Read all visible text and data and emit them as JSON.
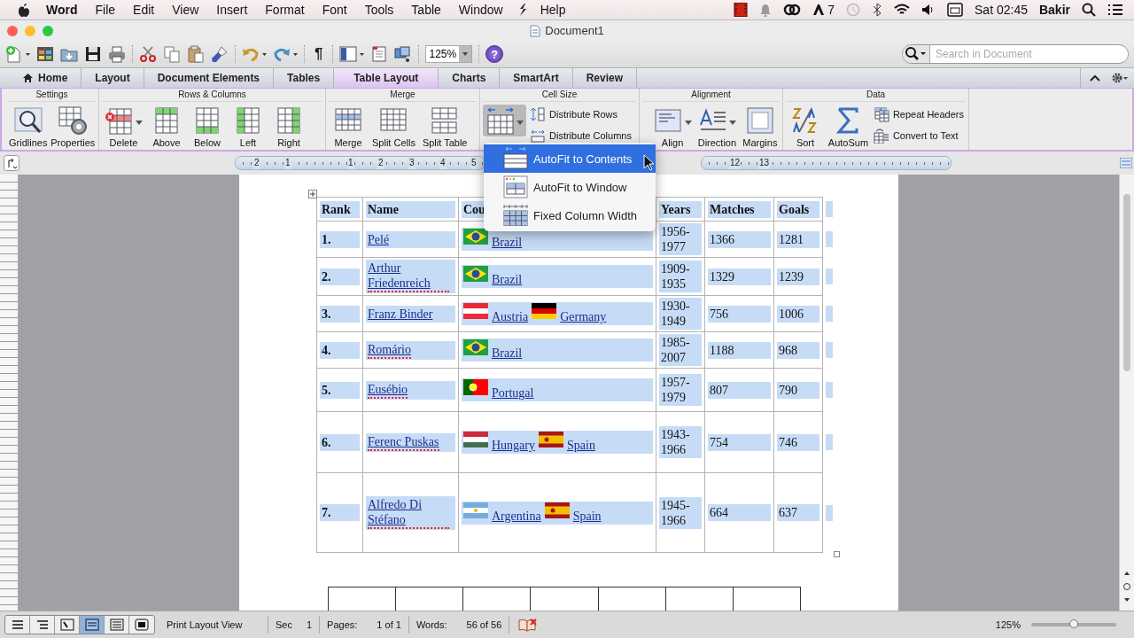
{
  "menubar": {
    "app": "Word",
    "items": [
      "File",
      "Edit",
      "View",
      "Insert",
      "Format",
      "Font",
      "Tools",
      "Table",
      "Window",
      "Help"
    ],
    "badge_count": "7",
    "clock": "Sat 02:45",
    "user": "Bakir"
  },
  "window": {
    "title": "Document1"
  },
  "toolbar": {
    "pilcrow": "¶",
    "zoom": "125%",
    "help": "?",
    "search": {
      "placeholder": "Search in Document"
    }
  },
  "ribbon": {
    "tabs": [
      {
        "label": "Home",
        "kind": "home",
        "selected": false
      },
      {
        "label": "Layout",
        "kind": "plain",
        "selected": false
      },
      {
        "label": "Document Elements",
        "kind": "plain",
        "selected": false
      },
      {
        "label": "Tables",
        "kind": "plain",
        "selected": false
      },
      {
        "label": "Table Layout",
        "kind": "plain",
        "selected": true
      },
      {
        "label": "Charts",
        "kind": "plain",
        "selected": false
      },
      {
        "label": "SmartArt",
        "kind": "plain",
        "selected": false
      },
      {
        "label": "Review",
        "kind": "plain",
        "selected": false
      }
    ],
    "groups": [
      {
        "title": "Settings",
        "buttons": [
          {
            "label": "Gridlines",
            "kind": "gridlines"
          },
          {
            "label": "Properties",
            "kind": "properties"
          }
        ]
      },
      {
        "title": "Rows & Columns",
        "buttons": [
          {
            "label": "Delete",
            "kind": "delete",
            "dropdown": true
          },
          {
            "label": "Above",
            "kind": "above"
          },
          {
            "label": "Below",
            "kind": "below"
          },
          {
            "label": "Left",
            "kind": "left"
          },
          {
            "label": "Right",
            "kind": "right"
          }
        ]
      },
      {
        "title": "Merge",
        "buttons": [
          {
            "label": "Merge",
            "kind": "merge"
          },
          {
            "label": "Split Cells",
            "kind": "split-cells"
          },
          {
            "label": "Split Table",
            "kind": "split-table"
          }
        ]
      },
      {
        "title": "Cell Size",
        "buttons": [
          {
            "kind": "autofit",
            "dropdown": true,
            "pressed": true
          }
        ],
        "small_buttons": [
          {
            "label": "Distribute Rows",
            "kind": "dist-rows"
          },
          {
            "label": "Distribute Columns",
            "kind": "dist-cols"
          }
        ]
      },
      {
        "title": "Alignment",
        "buttons": [
          {
            "label": "Align",
            "kind": "align",
            "dropdown": true
          },
          {
            "label": "Direction",
            "kind": "direction",
            "dropdown": true
          },
          {
            "label": "Margins",
            "kind": "margins"
          }
        ]
      },
      {
        "title": "Data",
        "buttons": [
          {
            "label": "Sort",
            "kind": "sort"
          },
          {
            "label": "AutoSum",
            "kind": "sum"
          }
        ],
        "small_buttons": [
          {
            "label": "Repeat Headers",
            "kind": "repeat"
          },
          {
            "label": "Convert to Text",
            "kind": "convert"
          }
        ]
      }
    ]
  },
  "ruler": {
    "labels": [
      "2",
      "1",
      "1",
      "2",
      "3",
      "4",
      "5",
      "12",
      "13"
    ]
  },
  "autofit_menu": {
    "items": [
      {
        "label": "AutoFit to Contents",
        "kind": "contents",
        "selected": true
      },
      {
        "label": "AutoFit to Window",
        "kind": "window",
        "selected": false
      },
      {
        "label": "Fixed Column Width",
        "kind": "fixed",
        "selected": false
      }
    ]
  },
  "table": {
    "selected": true,
    "columns": [
      "Rank",
      "Name",
      "Cou",
      "Years",
      "Matches",
      "Goals"
    ],
    "rows": [
      {
        "rank": "1.",
        "name": "Pelé",
        "misspelled": false,
        "countries": [
          {
            "name": "Brazil",
            "kind": "br"
          }
        ],
        "years": "1956-1977",
        "matches": "1366",
        "goals": "1281"
      },
      {
        "rank": "2.",
        "name": "Arthur Friedenreich",
        "misspelled": true,
        "countries": [
          {
            "name": "Brazil",
            "kind": "br"
          }
        ],
        "years": "1909-1935",
        "matches": "1329",
        "goals": "1239"
      },
      {
        "rank": "3.",
        "name": "Franz Binder",
        "misspelled": false,
        "countries": [
          {
            "name": "Austria",
            "kind": "at"
          },
          {
            "name": "Germany",
            "kind": "de"
          }
        ],
        "years": "1930-1949",
        "matches": "756",
        "goals": "1006"
      },
      {
        "rank": "4.",
        "name": "Romário",
        "misspelled": true,
        "countries": [
          {
            "name": "Brazil",
            "kind": "br"
          }
        ],
        "years": "1985-2007",
        "matches": "1188",
        "goals": "968"
      },
      {
        "rank": "5.",
        "name": "Eusébio",
        "misspelled": true,
        "countries": [
          {
            "name": "Portugal",
            "kind": "pt"
          }
        ],
        "years": "1957-1979",
        "matches": "807",
        "goals": "790"
      },
      {
        "rank": "6.",
        "name": "Ferenc Puskas",
        "misspelled": true,
        "countries": [
          {
            "name": "Hungary",
            "kind": "hu"
          },
          {
            "name": "Spain",
            "kind": "es"
          }
        ],
        "years": "1943-1966",
        "matches": "754",
        "goals": "746"
      },
      {
        "rank": "7.",
        "name": "Alfredo Di Stéfano",
        "misspelled": true,
        "countries": [
          {
            "name": "Argentina",
            "kind": "ar"
          },
          {
            "name": "Spain",
            "kind": "es"
          }
        ],
        "years": "1945-1966",
        "matches": "664",
        "goals": "637"
      }
    ]
  },
  "status_bar": {
    "views": [
      {
        "kind": "draft",
        "selected": false
      },
      {
        "kind": "outline",
        "selected": false
      },
      {
        "kind": "notebook",
        "selected": false
      },
      {
        "kind": "print",
        "selected": true
      },
      {
        "kind": "publishing",
        "selected": false
      },
      {
        "kind": "fullscreen",
        "selected": false
      }
    ],
    "view_name": "Print Layout View",
    "section_label": "Sec",
    "section": "1",
    "pages_label": "Pages:",
    "pages": "1 of 1",
    "words_label": "Words:",
    "words": "56 of 56",
    "zoom": "125%",
    "zoom_slider": {
      "level": 0.5
    }
  }
}
